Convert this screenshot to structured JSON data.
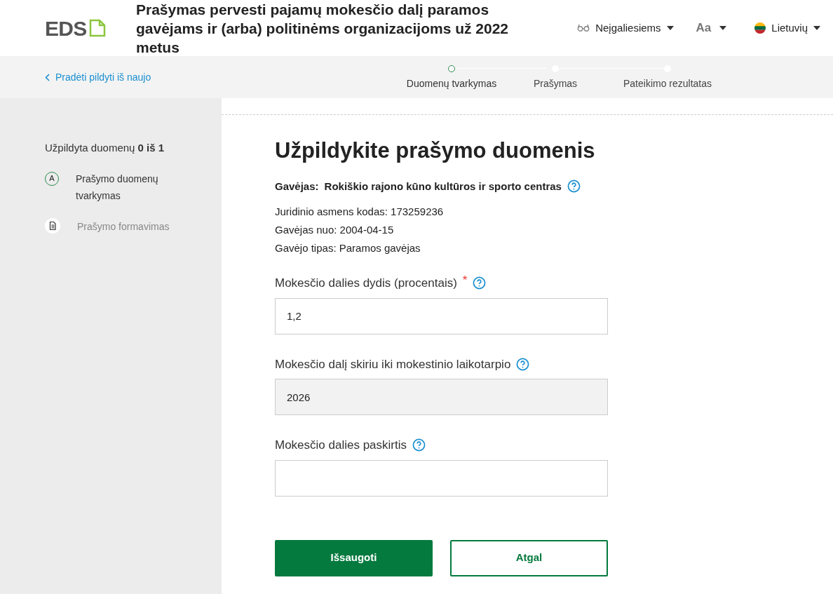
{
  "header": {
    "logo": "EDS",
    "title": "Prašymas pervesti pajamų mokesčio dalį paramos gavėjams ir (arba) politinėms organizacijoms už 2022 metus",
    "accessibility": "Neįgaliesiems",
    "font_size": "Aa",
    "language": "Lietuvių"
  },
  "subbar": {
    "back_link": "Pradėti pildyti iš naujo",
    "steps": [
      {
        "label": "Duomenų tvarkymas",
        "selected": true
      },
      {
        "label": "Prašymas",
        "selected": false
      },
      {
        "label": "Pateikimo rezultatas",
        "selected": false
      }
    ]
  },
  "sidebar": {
    "progress": "Užpildyta duomenų **0 iš 1**",
    "items": [
      {
        "kind": "letter",
        "badge": "A",
        "label": "Prašymo duomenų tvarkymas",
        "selected": true
      },
      {
        "kind": "document",
        "label": "Prašymo formavimas",
        "selected": false
      }
    ]
  },
  "main": {
    "heading": "Užpildykite prašymo duomenis",
    "recipient_label": "Gavėjas:",
    "recipient_name": "Rokiškio rajono kūno kultūros ir sporto centras",
    "details": [
      "Juridinio asmens kodas: 173259236",
      "Gavėjas nuo: 2004-04-15",
      "Gavėjo tipas: Paramos gavėjas"
    ],
    "fields": [
      {
        "label": "Mokesčio dalies dydis (procentais)",
        "required_mark": "*",
        "value": "1,2",
        "disabled": false
      },
      {
        "label": "Mokesčio dalį skiriu iki mokestinio laikotarpio",
        "value": "2026",
        "disabled": true
      },
      {
        "label": "Mokesčio dalies paskirtis",
        "disabled": false
      }
    ],
    "buttons": [
      {
        "label": "Išsaugoti",
        "kind": "primary"
      },
      {
        "label": "Atgal",
        "kind": "secondary"
      }
    ]
  }
}
